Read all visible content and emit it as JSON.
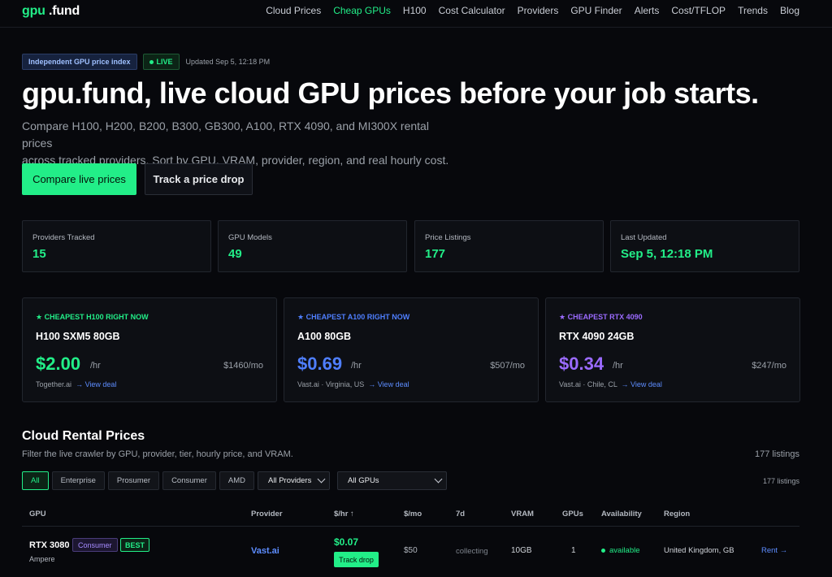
{
  "brand": {
    "part1": "gpu",
    "part2": " .fund"
  },
  "nav": [
    "Cloud Prices",
    "Cheap GPUs",
    "H100",
    "Cost Calculator",
    "Providers",
    "GPU Finder",
    "Alerts",
    "Cost/TFLOP",
    "Trends",
    "Blog"
  ],
  "nav_active": "Cheap GPUs",
  "badges": {
    "index": "Independent GPU price index",
    "live": "LIVE",
    "updated": "Updated Sep 5, 12:18 PM"
  },
  "hero": {
    "title": "gpu.fund, live cloud GPU prices before your job starts.",
    "subtitle_line1": "Compare H100, H200, B200, B300, GB300, A100, RTX 4090, and MI300X rental prices",
    "subtitle_line2": "across tracked providers. Sort by GPU, VRAM, provider, region, and real hourly cost.",
    "cta_primary": "Compare live prices",
    "cta_secondary": "Track a price drop"
  },
  "stats": [
    {
      "label": "Providers Tracked",
      "value": "15"
    },
    {
      "label": "GPU Models",
      "value": "49"
    },
    {
      "label": "Price Listings",
      "value": "177"
    },
    {
      "label": "Last Updated",
      "value": "Sep 5, 12:18 PM"
    }
  ],
  "deals": [
    {
      "kicker": "★ CHEAPEST H100 RIGHT NOW",
      "model": "H100 SXM5 80GB",
      "price": "$2.00",
      "per": "/hr",
      "monthly": "$1460/mo",
      "source": "Together.ai",
      "link": "→ View deal",
      "color": "#22ee88"
    },
    {
      "kicker": "★ CHEAPEST A100 RIGHT NOW",
      "model": "A100 80GB",
      "price": "$0.69",
      "per": "/hr",
      "monthly": "$507/mo",
      "source": "Vast.ai · Virginia, US",
      "link": "→ View deal",
      "color": "#4f7fff"
    },
    {
      "kicker": "★ CHEAPEST RTX 4090",
      "model": "RTX 4090 24GB",
      "price": "$0.34",
      "per": "/hr",
      "monthly": "$247/mo",
      "source": "Vast.ai · Chile, CL",
      "link": "→ View deal",
      "color": "#9b6bff"
    }
  ],
  "section": {
    "title": "Cloud Rental Prices",
    "subtitle": "Filter the live crawler by GPU, provider, tier, hourly price, and VRAM.",
    "listings": "177 listings"
  },
  "filters": {
    "tabs": [
      "All",
      "Enterprise",
      "Prosumer",
      "Consumer",
      "AMD"
    ],
    "active_tab": "All",
    "providers_select": "All Providers",
    "gpus_select": "All GPUs"
  },
  "table": {
    "headers": [
      "GPU",
      "Provider",
      "$/hr ↑",
      "$/mo",
      "7d",
      "VRAM",
      "GPUs",
      "Availability",
      "Region"
    ],
    "rows": [
      {
        "gpu": "RTX 3080",
        "arch": "Ampere",
        "tier": "Consumer",
        "best": "BEST",
        "provider": "Vast.ai",
        "hourly": "$0.07",
        "track": "Track drop",
        "monthly": "$50",
        "trend": "collecting",
        "vram": "10GB",
        "gpus": "1",
        "availability": "available",
        "region": "United Kingdom, GB",
        "action": "Rent →"
      }
    ]
  }
}
